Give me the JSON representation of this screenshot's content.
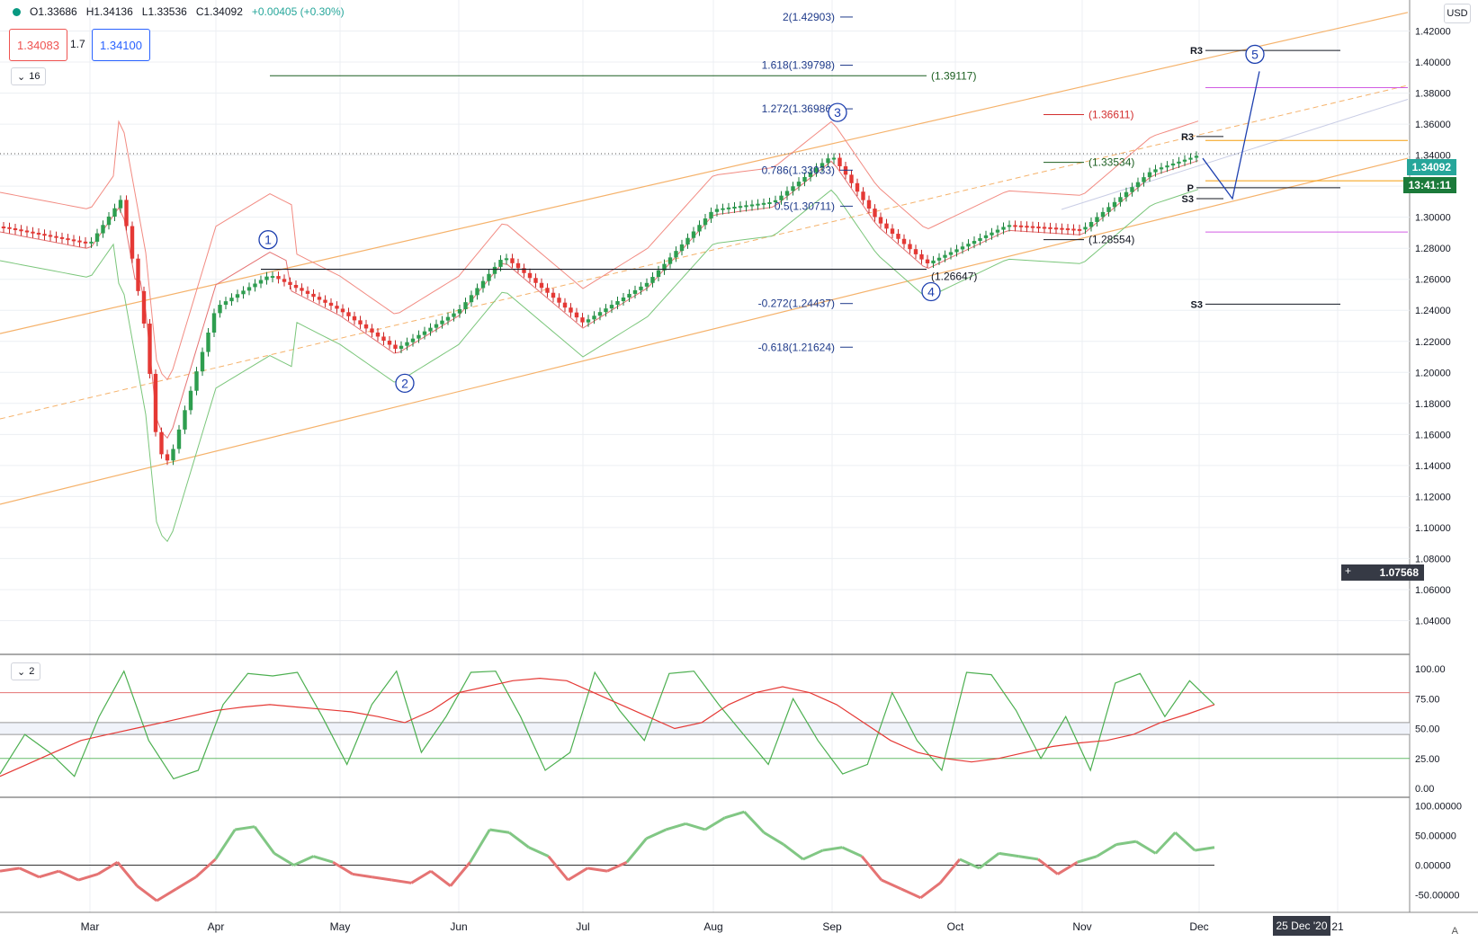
{
  "legend": {
    "open": "O1.33686",
    "high": "H1.34136",
    "low": "L1.33536",
    "close": "C1.34092",
    "change": "+0.00405 (+0.30%)"
  },
  "order": {
    "sell": "1.34083",
    "spread": "1.7",
    "buy": "1.34100"
  },
  "collapse_main": "16",
  "collapse_osc": "2",
  "currency": "USD",
  "corner": "A",
  "last_price": "1.34092",
  "countdown": "13:41:11",
  "crosshair_price": "1.07568",
  "crosshair_date": "25 Dec '20",
  "colors": {
    "up": "#26a69a",
    "down": "#ef5350",
    "bb_upper": "#f28b82",
    "bb_lower": "#7bc67b",
    "channel": "#f5b26b",
    "ema": "#4caf50",
    "fib": "#1e3a8a"
  },
  "chart_data": [
    {
      "type": "line",
      "note_kind": "candlestick",
      "symbol_quote": "USD",
      "x": [
        "Feb 15",
        "Mar 1",
        "Mar 8",
        "Mar 15",
        "Mar 19",
        "Mar 23",
        "Apr 1",
        "Apr 15",
        "May 1",
        "May 18",
        "Jun 1",
        "Jun 10",
        "Jul 1",
        "Jul 15",
        "Aug 1",
        "Aug 15",
        "Sep 1",
        "Sep 14",
        "Sep 25",
        "Oct 15",
        "Nov 1",
        "Nov 20",
        "Dec 4"
      ],
      "y": [
        1.294,
        1.283,
        1.312,
        1.225,
        1.15,
        1.142,
        1.242,
        1.263,
        1.24,
        1.215,
        1.24,
        1.275,
        1.232,
        1.258,
        1.305,
        1.31,
        1.34,
        1.298,
        1.27,
        1.295,
        1.292,
        1.33,
        1.34092
      ],
      "ylim": [
        1.02,
        1.44
      ],
      "y_ticks": [
        "1.04000",
        "1.06000",
        "1.08000",
        "1.10000",
        "1.12000",
        "1.14000",
        "1.16000",
        "1.18000",
        "1.20000",
        "1.22000",
        "1.24000",
        "1.26000",
        "1.28000",
        "1.30000",
        "1.32000",
        "1.34000",
        "1.36000",
        "1.38000",
        "1.40000",
        "1.42000"
      ],
      "x_ticks": [
        "Mar",
        "Apr",
        "May",
        "Jun",
        "Jul",
        "Aug",
        "Sep",
        "Oct",
        "Nov",
        "Dec",
        "21"
      ],
      "fib_levels": [
        {
          "label": "2(1.42903)",
          "value": 1.42903
        },
        {
          "label": "1.618(1.39798)",
          "value": 1.39798
        },
        {
          "label": "1.272(1.36986)",
          "value": 1.36986
        },
        {
          "label": "0.786(1.33033)",
          "value": 1.33033
        },
        {
          "label": "0.5(1.30711)",
          "value": 1.30711
        },
        {
          "label": "-0.272(1.24437)",
          "value": 1.24437
        },
        {
          "label": "-0.618(1.21624)",
          "value": 1.21624
        }
      ],
      "levels": [
        {
          "label": "(1.39117)",
          "value": 1.39117
        },
        {
          "label": "(1.36611)",
          "value": 1.36611
        },
        {
          "label": "(1.33534)",
          "value": 1.33534
        },
        {
          "label": "(1.28554)",
          "value": 1.28554
        },
        {
          "label": "(1.26647)",
          "value": 1.26647
        }
      ],
      "pivots": [
        {
          "label": "R3",
          "value": 1.4075
        },
        {
          "label": "R3",
          "value": 1.352
        },
        {
          "label": "P",
          "value": 1.319
        },
        {
          "label": "S3",
          "value": 1.312
        },
        {
          "label": "S3",
          "value": 1.244
        }
      ],
      "waves": [
        "1",
        "2",
        "3",
        "4",
        "5"
      ]
    },
    {
      "type": "line",
      "note_kind": "stochastic",
      "ylim": [
        0,
        100
      ],
      "y_ticks": [
        "0.00",
        "25.00",
        "50.00",
        "75.00",
        "100.00"
      ],
      "bands": [
        80,
        50,
        45,
        25
      ],
      "series_k": [
        12,
        45,
        30,
        10,
        60,
        98,
        40,
        8,
        15,
        70,
        96,
        94,
        97,
        60,
        20,
        70,
        98,
        30,
        60,
        97,
        98,
        60,
        15,
        30,
        97,
        65,
        40,
        96,
        98,
        70,
        45,
        20,
        75,
        40,
        12,
        20,
        80,
        40,
        15,
        97,
        95,
        65,
        25,
        60,
        15,
        88,
        96,
        60,
        90,
        70
      ],
      "series_d": [
        10,
        20,
        30,
        40,
        45,
        50,
        55,
        60,
        65,
        68,
        70,
        68,
        66,
        64,
        60,
        55,
        65,
        80,
        85,
        90,
        92,
        90,
        80,
        70,
        60,
        50,
        55,
        70,
        80,
        85,
        80,
        70,
        55,
        40,
        30,
        25,
        22,
        25,
        30,
        35,
        38,
        40,
        45,
        55,
        62,
        70
      ]
    },
    {
      "type": "line",
      "note_kind": "momentum",
      "ylim": [
        -75,
        110
      ],
      "y_ticks": [
        "-50.00000",
        "0.00000",
        "50.00000",
        "100.00000"
      ],
      "zero_line": 0,
      "series": [
        -10,
        -5,
        -20,
        -10,
        -25,
        -15,
        5,
        -35,
        -60,
        -40,
        -20,
        10,
        60,
        65,
        20,
        0,
        15,
        5,
        -15,
        -20,
        -25,
        -30,
        -10,
        -35,
        5,
        60,
        55,
        30,
        15,
        -25,
        -5,
        -10,
        5,
        45,
        60,
        70,
        60,
        80,
        90,
        55,
        35,
        10,
        25,
        30,
        15,
        -25,
        -40,
        -55,
        -30,
        10,
        -5,
        20,
        15,
        10,
        -15,
        5,
        15,
        35,
        40,
        20,
        55,
        25,
        30
      ]
    }
  ]
}
